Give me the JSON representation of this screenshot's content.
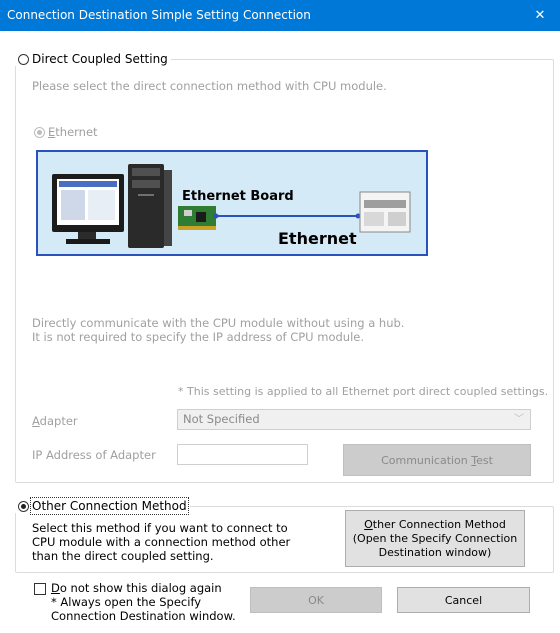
{
  "window": {
    "title": "Connection Destination Simple Setting Connection",
    "close_glyph": "✕"
  },
  "direct": {
    "legend": "Direct Coupled Setting",
    "prompt": "Please select the direct connection method with CPU module.",
    "ethernet_option": "Ethernet",
    "illustration": {
      "board_label": "Ethernet Board",
      "cable_label": "Ethernet"
    },
    "desc_line1": "Directly communicate with the CPU module without using a hub.",
    "desc_line2": "It is not required to specify the IP address of CPU module.",
    "note": "* This setting is applied to all Ethernet port direct coupled settings.",
    "adapter_label": "Adapter",
    "adapter_value": "Not Specified",
    "ip_label": "IP Address of Adapter",
    "ip_value": "",
    "comm_test_prefix": "Communication ",
    "comm_test_key": "T",
    "comm_test_suffix": "est"
  },
  "other": {
    "legend": "Other Connection Method",
    "desc_line1": "Select this method if you want to connect to",
    "desc_line2": "CPU module with a connection method other",
    "desc_line3": "than the direct coupled setting.",
    "button_line1_key": "O",
    "button_line1_rest": "ther Connection Method",
    "button_line2": "(Open the Specify Connection",
    "button_line3": "Destination window)"
  },
  "footer": {
    "checkbox_key": "D",
    "checkbox_rest": "o not show this dialog again",
    "checkbox_note1": "* Always open the Specify",
    "checkbox_note2": "Connection Destination window.",
    "ok_label": "OK",
    "cancel_label": "Cancel"
  },
  "colors": {
    "titlebar": "#0078d7",
    "illustration_border": "#2a52be",
    "illustration_bg": "#d4eaf6"
  }
}
